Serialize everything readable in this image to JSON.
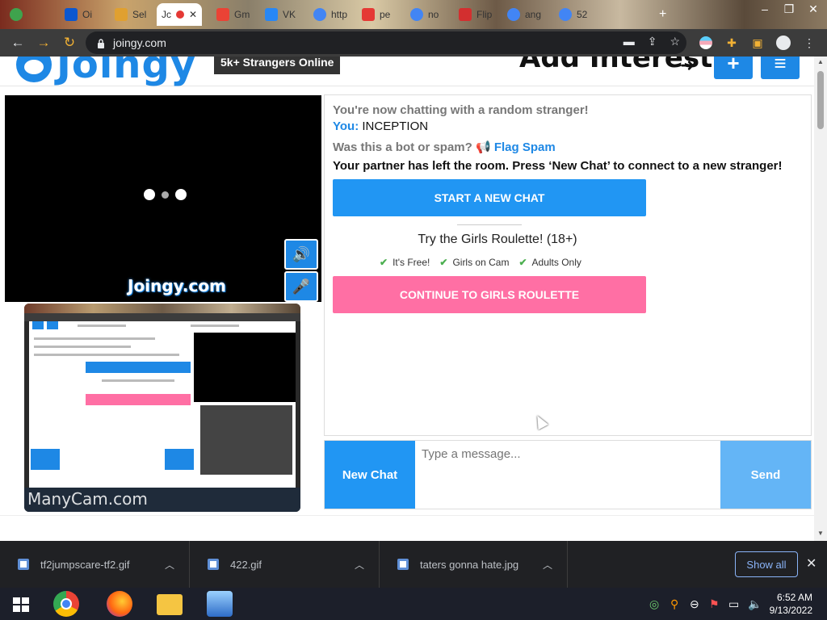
{
  "browser": {
    "tabs": [
      {
        "title": "Oi",
        "favicon_color": "#0b57d0"
      },
      {
        "title": "Sel",
        "favicon_color": "#e0a030"
      },
      {
        "title": "Jc",
        "favicon_color": "#1e88e5",
        "active": true
      },
      {
        "title": "Gm",
        "favicon_color": "#ea4335"
      },
      {
        "title": "VK",
        "favicon_color": "#2787f5"
      },
      {
        "title": "http",
        "favicon_color": "#4285f4"
      },
      {
        "title": "pe",
        "favicon_color": "#e53935"
      },
      {
        "title": "no",
        "favicon_color": "#4285f4"
      },
      {
        "title": "Flip",
        "favicon_color": "#d32f2f"
      },
      {
        "title": "ang",
        "favicon_color": "#4285f4"
      },
      {
        "title": "52",
        "favicon_color": "#4285f4"
      }
    ],
    "url": "joingy.com"
  },
  "site": {
    "logo_text": "Joingy",
    "online_badge": "5k+ Strangers Online",
    "add_interests": "Add Interests",
    "plus_label": "+",
    "menu_label": "≡",
    "video_watermark": "Joingy.com",
    "selfcam_watermark": "ManyCam.com"
  },
  "chat": {
    "status": "You're now chatting with a random stranger!",
    "you_label": "You:",
    "you_message": "INCEPTION",
    "bot_question": "Was this a bot or spam?",
    "flag_spam": "Flag Spam",
    "partner_left": "Your partner has left the room. Press ‘New Chat’ to connect to a new stranger!",
    "start_new_chat": "START A NEW CHAT",
    "roulette_title": "Try the Girls Roulette! (18+)",
    "features": [
      "It's Free!",
      "Girls on Cam",
      "Adults Only"
    ],
    "continue_roulette": "CONTINUE TO GIRLS ROULETTE"
  },
  "composer": {
    "new_chat": "New Chat",
    "placeholder": "Type a message...",
    "send": "Send"
  },
  "downloads": {
    "items": [
      "tf2jumpscare-tf2.gif",
      "422.gif",
      "taters gonna hate.jpg"
    ],
    "show_all": "Show all"
  },
  "taskbar": {
    "time": "6:52 AM",
    "date": "9/13/2022"
  }
}
